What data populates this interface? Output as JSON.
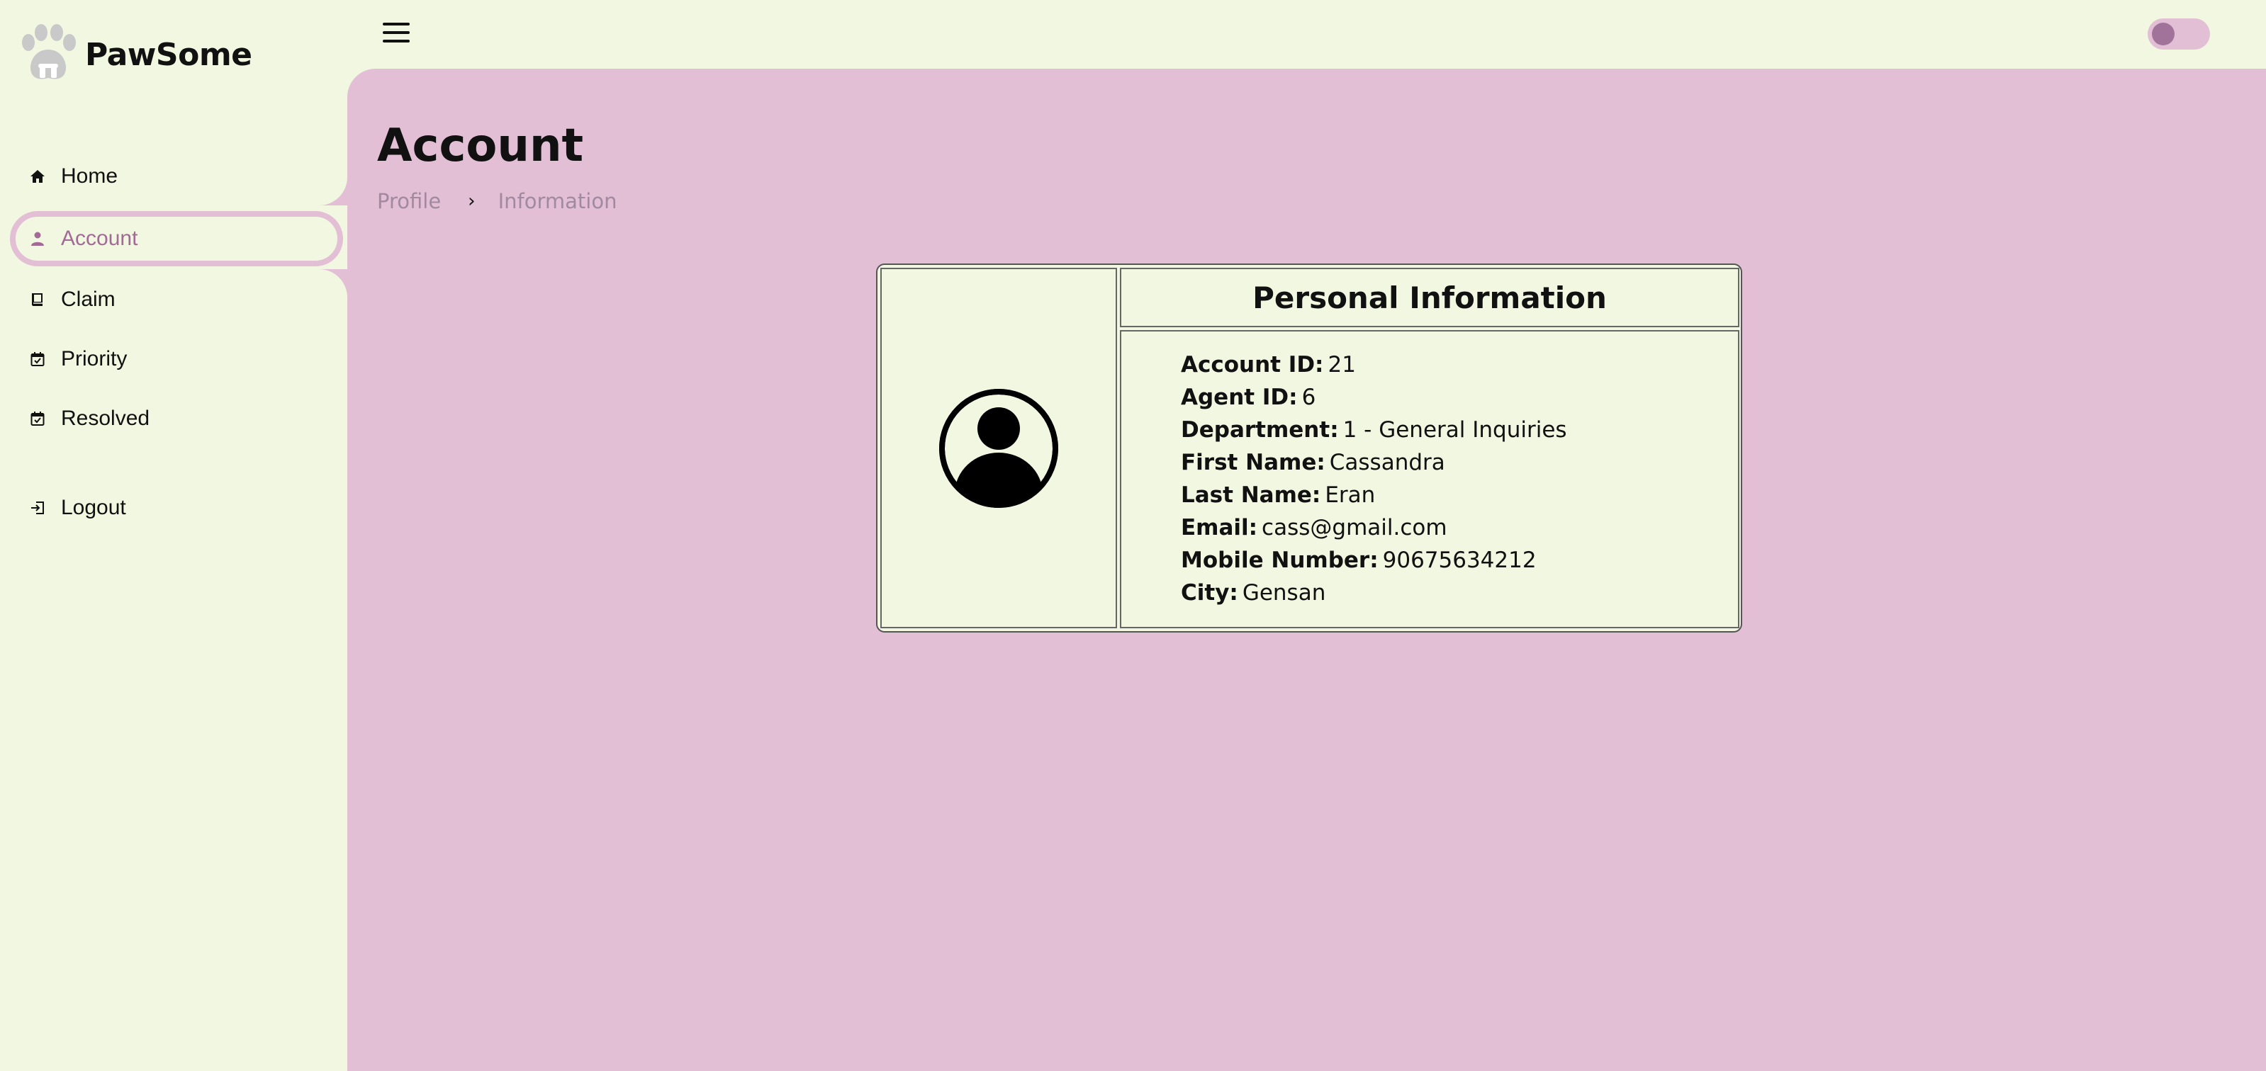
{
  "app": {
    "name": "PawSome"
  },
  "sidebar": {
    "items": [
      {
        "label": "Home",
        "icon": "home-icon"
      },
      {
        "label": "Account",
        "icon": "person-icon",
        "active": true
      },
      {
        "label": "Claim",
        "icon": "book-icon"
      },
      {
        "label": "Priority",
        "icon": "calendar-icon"
      },
      {
        "label": "Resolved",
        "icon": "calendar-icon"
      },
      {
        "label": "Logout",
        "icon": "logout-icon"
      }
    ]
  },
  "topbar": {
    "menu_icon": "hamburger-icon",
    "theme_toggle": {
      "on": false
    }
  },
  "main": {
    "title": "Account",
    "breadcrumb": [
      "Profile",
      "Information"
    ],
    "breadcrumb_sep": "›"
  },
  "card": {
    "title": "Personal Information",
    "avatar_icon": "user-circle-icon",
    "fields": [
      {
        "key": "Account ID:",
        "value": "21"
      },
      {
        "key": "Agent ID:",
        "value": "6"
      },
      {
        "key": "Department:",
        "value": "1 - General Inquiries"
      },
      {
        "key": "First Name:",
        "value": "Cassandra"
      },
      {
        "key": "Last Name:",
        "value": "Eran"
      },
      {
        "key": "Email:",
        "value": "cass@gmail.com"
      },
      {
        "key": "Mobile Number:",
        "value": "90675634212"
      },
      {
        "key": "City:",
        "value": "Gensan"
      }
    ]
  },
  "colors": {
    "sidebar_bg": "#f2f7e1",
    "main_bg": "#e2bfd5",
    "accent": "#a26a96",
    "breadcrumb": "#a18aa0"
  }
}
